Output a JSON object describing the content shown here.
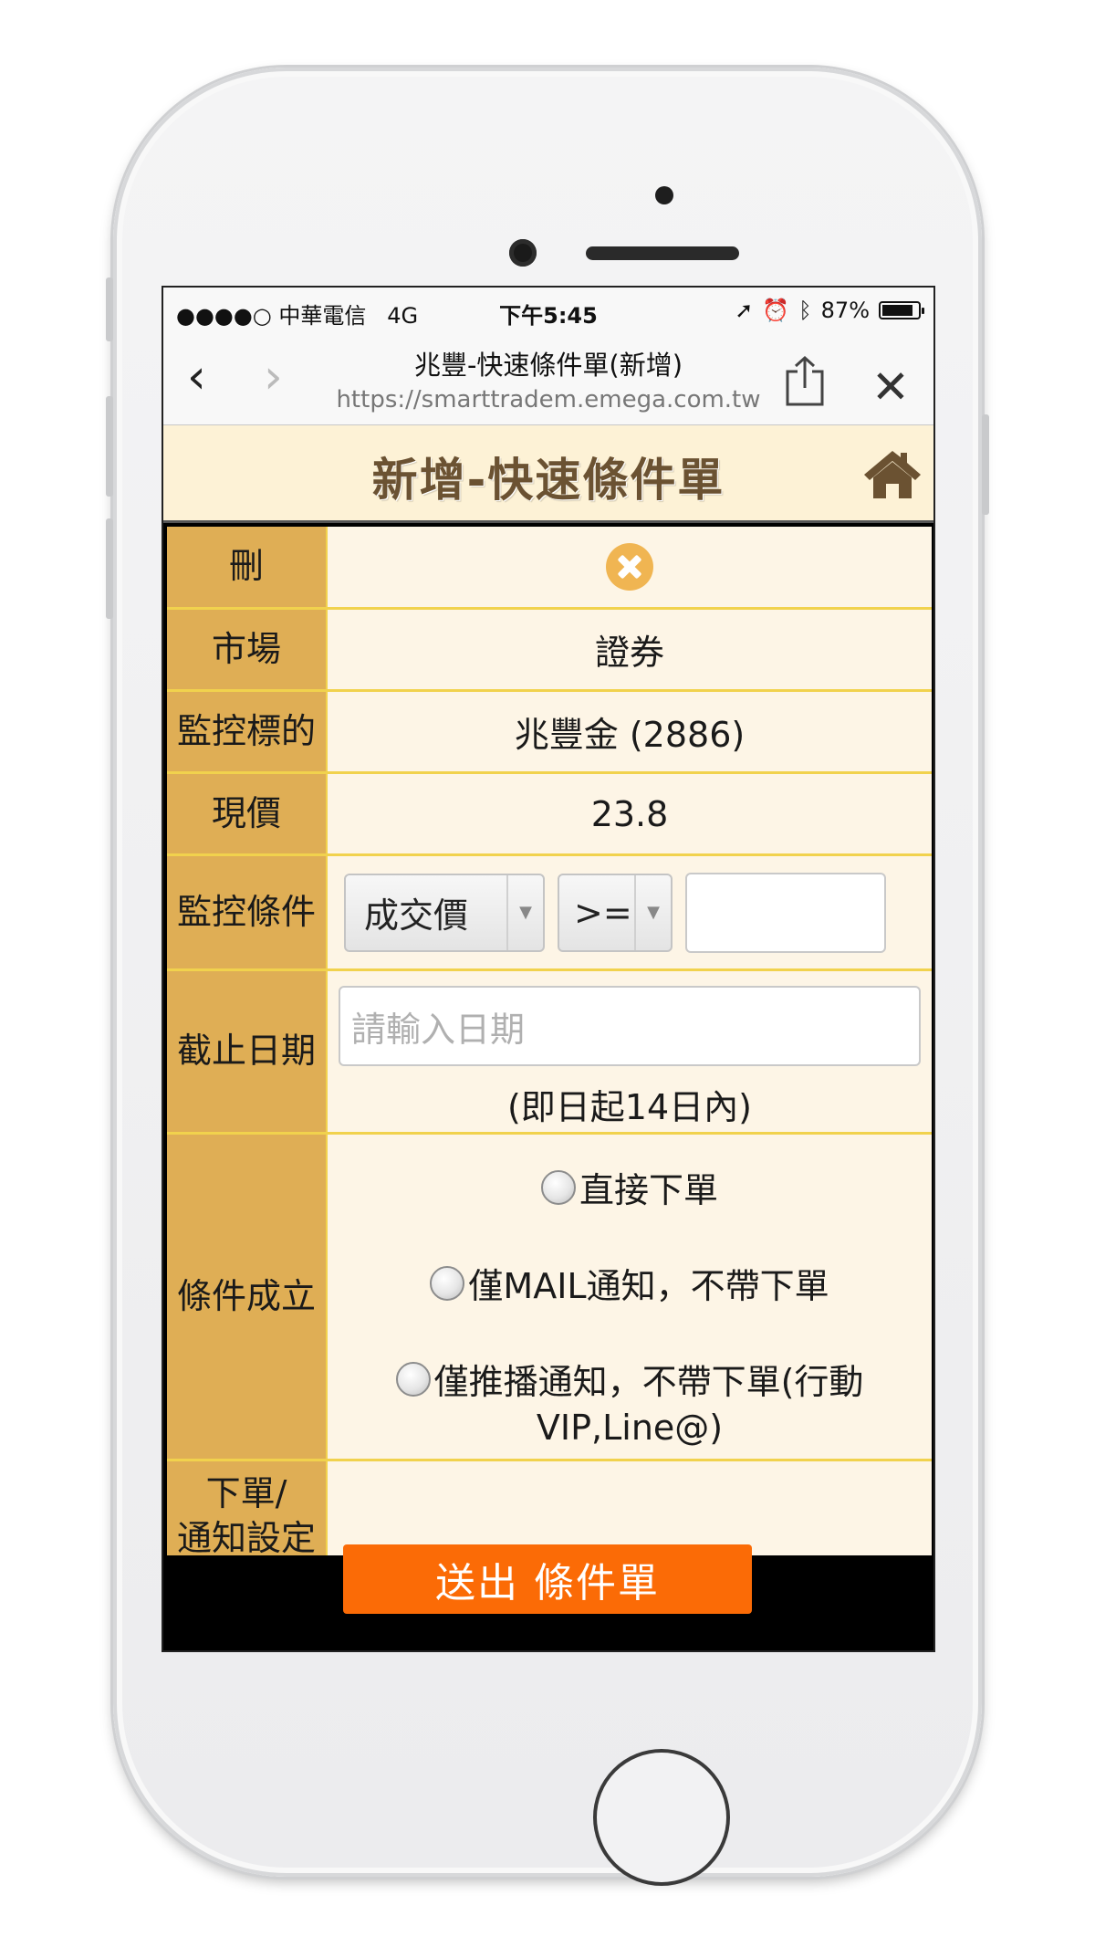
{
  "status_bar": {
    "carrier": "●●●●○ 中華電信",
    "network": "4G",
    "time": "下午5:45",
    "battery": "87%",
    "battery_level": 0.87
  },
  "browser": {
    "page_title": "兆豐-快速條件單(新增)",
    "url": "https://smarttradem.emega.com.tw"
  },
  "header": {
    "title": "新增-快速條件單"
  },
  "form": {
    "delete_label": "刪",
    "market_label": "市場",
    "market_value": "證券",
    "target_label": "監控標的",
    "target_value": "兆豐金 (2886)",
    "price_label": "現價",
    "price_value": "23.8",
    "condition_label": "監控條件",
    "condition_field": "成交價",
    "condition_operator": ">=",
    "condition_value": "",
    "expiry_label": "截止日期",
    "expiry_placeholder": "請輸入日期",
    "expiry_note": "(即日起14日內)",
    "trigger_label": "條件成立",
    "trigger_options": [
      "直接下單",
      "僅MAIL通知，不帶下單",
      "僅推播通知，不帶下單(行動",
      "VIP,Line@)"
    ],
    "notify_label_line1": "下單/",
    "notify_label_line2": "通知設定"
  },
  "submit_label": "送出 條件單",
  "colors": {
    "label_bg": "#dfae55",
    "cell_bg": "#fdf5e6",
    "border": "#f1d24d",
    "header_bg": "#fdf2d6",
    "submit_bg": "#fb6b06"
  }
}
